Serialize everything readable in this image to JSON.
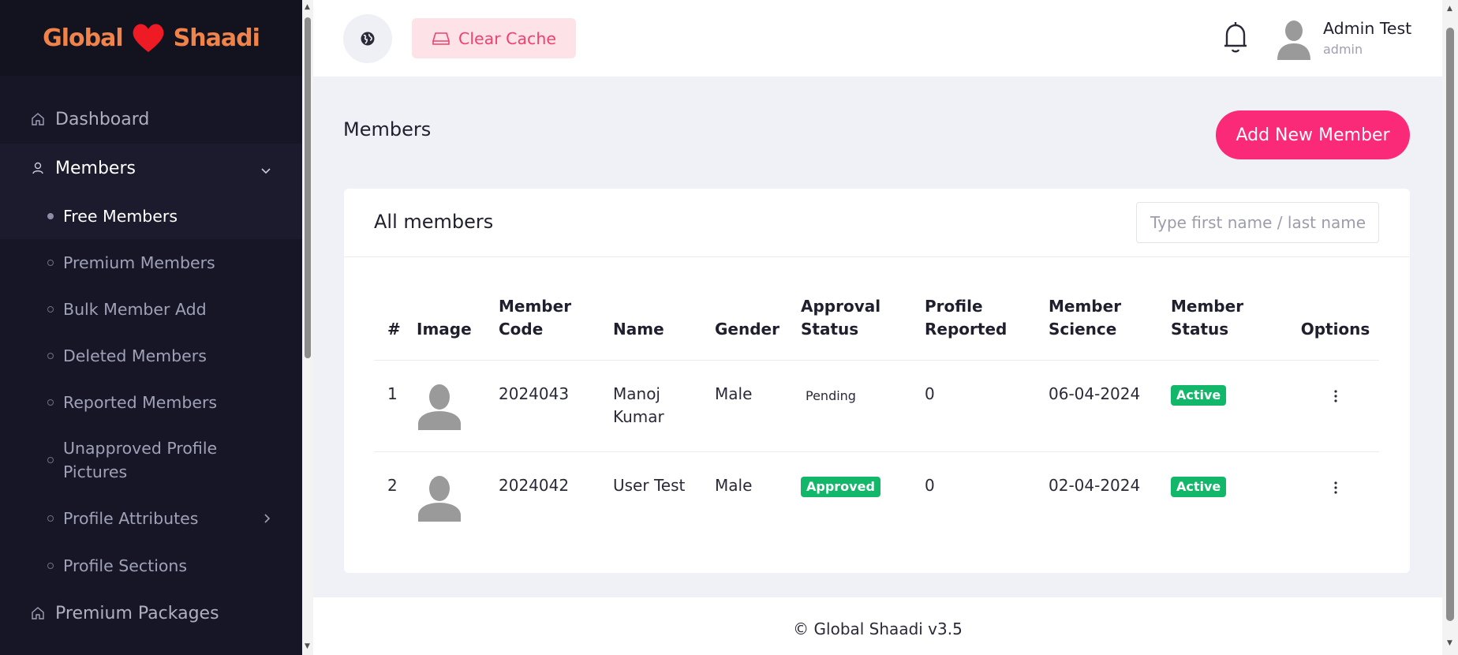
{
  "brand": {
    "word_left": "Global",
    "word_right": "Shaadi",
    "color_word": "#f0834a",
    "color_heart": "#ee1b24"
  },
  "sidebar": {
    "items": [
      {
        "label": "Dashboard",
        "icon": "home-icon"
      },
      {
        "label": "Members",
        "icon": "user-icon",
        "expanded": true
      },
      {
        "label": "Premium Packages",
        "icon": "home-icon"
      }
    ],
    "members_sub": [
      {
        "label": "Free Members",
        "active": true
      },
      {
        "label": "Premium Members"
      },
      {
        "label": "Bulk Member Add"
      },
      {
        "label": "Deleted Members"
      },
      {
        "label": "Reported Members"
      },
      {
        "label": "Unapproved Profile Pictures"
      },
      {
        "label": "Profile Attributes",
        "has_children": true
      },
      {
        "label": "Profile Sections"
      }
    ]
  },
  "topbar": {
    "clear_cache_label": "Clear Cache",
    "user_name": "Admin Test",
    "user_role": "admin"
  },
  "page": {
    "title": "Members",
    "add_button_label": "Add New Member"
  },
  "card": {
    "title": "All members",
    "search_placeholder": "Type first name / last name"
  },
  "table": {
    "headers": {
      "num": "#",
      "image": "Image",
      "code": "Member Code",
      "name": "Name",
      "gender": "Gender",
      "approval": "Approval Status",
      "reported": "Profile Reported",
      "science": "Member Science",
      "status": "Member Status",
      "options": "Options"
    },
    "rows": [
      {
        "num": "1",
        "code": "2024043",
        "name": "Manoj Kumar",
        "gender": "Male",
        "approval": "Pending",
        "reported": "0",
        "science": "06-04-2024",
        "status": "Active"
      },
      {
        "num": "2",
        "code": "2024042",
        "name": "User Test",
        "gender": "Male",
        "approval": "Approved",
        "reported": "0",
        "science": "02-04-2024",
        "status": "Active"
      }
    ]
  },
  "footer": {
    "text": "© Global Shaadi v3.5"
  },
  "colors": {
    "sidebar_bg": "#171626",
    "accent_pink": "#fb2a78",
    "cache_pink": "#f0416e",
    "badge_green": "#12b76a"
  }
}
